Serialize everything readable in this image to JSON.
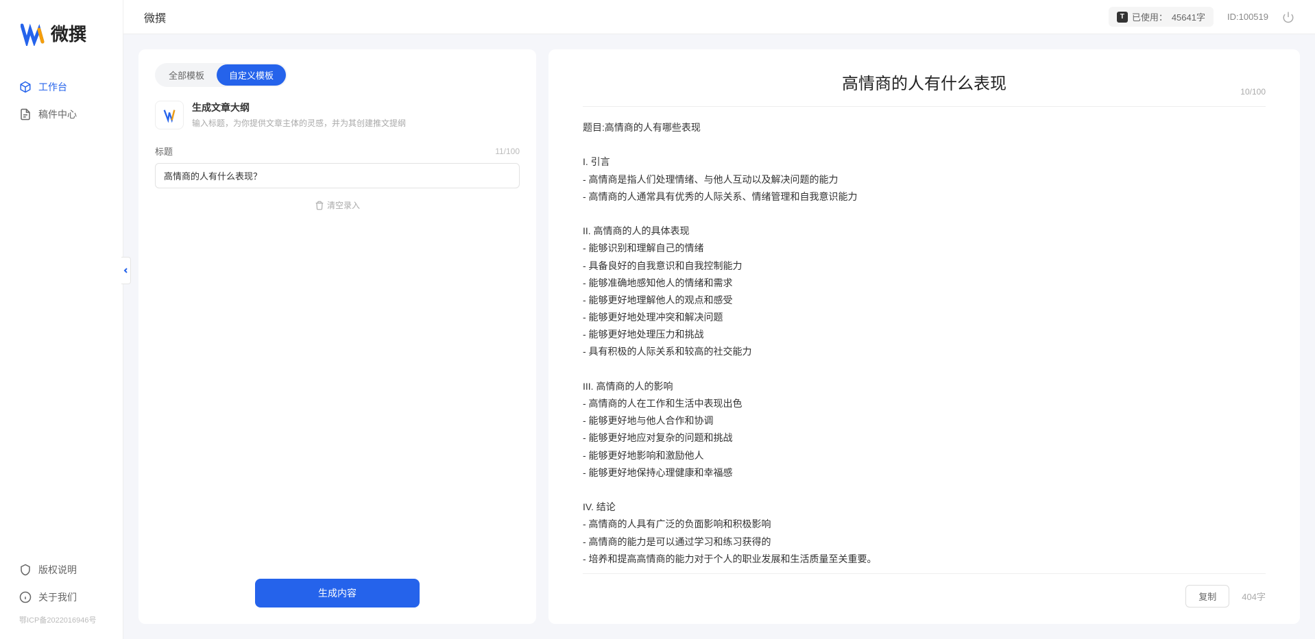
{
  "app": {
    "name": "微撰",
    "logo_colors": [
      "#2563eb",
      "#2563eb",
      "#f59e0b"
    ]
  },
  "sidebar": {
    "items": [
      {
        "label": "工作台",
        "active": true
      },
      {
        "label": "稿件中心",
        "active": false
      }
    ],
    "bottom_items": [
      {
        "label": "版权说明"
      },
      {
        "label": "关于我们"
      }
    ],
    "footer": "鄂ICP备2022016946号"
  },
  "topbar": {
    "title": "微撰",
    "usage_label": "已使用：",
    "usage_value": "45641字",
    "id_label": "ID:",
    "id_value": "100519"
  },
  "left_panel": {
    "tabs": [
      {
        "label": "全部模板",
        "active": false
      },
      {
        "label": "自定义模板",
        "active": true
      }
    ],
    "template": {
      "name": "生成文章大纲",
      "desc": "输入标题，为你提供文章主体的灵感，并为其创建推文提纲"
    },
    "title_field": {
      "label": "标题",
      "count": "11/100",
      "value": "高情商的人有什么表现？"
    },
    "clear_label": "清空录入",
    "generate_label": "生成内容"
  },
  "right_panel": {
    "title": "高情商的人有什么表现",
    "title_count": "10/100",
    "body": "题目:高情商的人有哪些表现\n\nI. 引言\n- 高情商是指人们处理情绪、与他人互动以及解决问题的能力\n- 高情商的人通常具有优秀的人际关系、情绪管理和自我意识能力\n\nII. 高情商的人的具体表现\n- 能够识别和理解自己的情绪\n- 具备良好的自我意识和自我控制能力\n- 能够准确地感知他人的情绪和需求\n- 能够更好地理解他人的观点和感受\n- 能够更好地处理冲突和解决问题\n- 能够更好地处理压力和挑战\n- 具有积极的人际关系和较高的社交能力\n\nIII. 高情商的人的影响\n- 高情商的人在工作和生活中表现出色\n- 能够更好地与他人合作和协调\n- 能够更好地应对复杂的问题和挑战\n- 能够更好地影响和激励他人\n- 能够更好地保持心理健康和幸福感\n\nIV. 结论\n- 高情商的人具有广泛的负面影响和积极影响\n- 高情商的能力是可以通过学习和练习获得的\n- 培养和提高高情商的能力对于个人的职业发展和生活质量至关重要。",
    "copy_label": "复制",
    "char_count": "404字"
  }
}
